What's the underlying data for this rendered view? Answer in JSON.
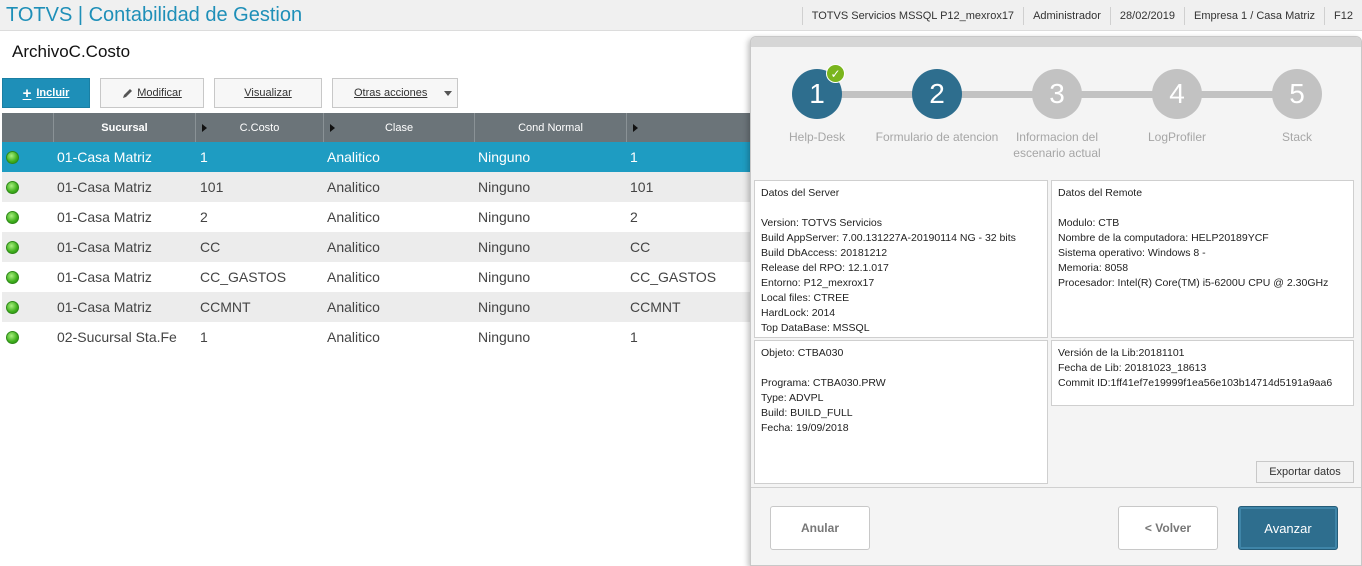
{
  "app": {
    "title": "TOTVS | Contabilidad de Gestion",
    "server": "TOTVS Servicios MSSQL P12_mexrox17",
    "user": "Administrador",
    "date": "28/02/2019",
    "company": "Empresa 1 / Casa Matriz",
    "key": "F12"
  },
  "page": {
    "title": "ArchivoC.Costo"
  },
  "toolbar": {
    "incluir": "Incluir",
    "modificar": "Modificar",
    "visualizar": "Visualizar",
    "otras": "Otras acciones"
  },
  "grid": {
    "columns": [
      "Sucursal",
      "C.Costo",
      "Clase",
      "Cond Normal",
      ""
    ],
    "rows": [
      [
        "01-Casa Matriz",
        "1",
        "Analitico",
        "Ninguno",
        "1"
      ],
      [
        "01-Casa Matriz",
        "101",
        "Analitico",
        "Ninguno",
        "101"
      ],
      [
        "01-Casa Matriz",
        "2",
        "Analitico",
        "Ninguno",
        "2"
      ],
      [
        "01-Casa Matriz",
        "CC",
        "Analitico",
        "Ninguno",
        "CC"
      ],
      [
        "01-Casa Matriz",
        "CC_GASTOS",
        "Analitico",
        "Ninguno",
        "CC_GASTOS"
      ],
      [
        "01-Casa Matriz",
        "CCMNT",
        "Analitico",
        "Ninguno",
        "CCMNT"
      ],
      [
        "02-Sucursal Sta.Fe",
        "1",
        "Analitico",
        "Ninguno",
        "1"
      ]
    ],
    "selected_row": 0,
    "status_color": "#3fae1c"
  },
  "wizard": {
    "steps": [
      {
        "number": "1",
        "label": "Help-Desk",
        "state": "done"
      },
      {
        "number": "2",
        "label": "Formulario de atencion",
        "state": "current"
      },
      {
        "number": "3",
        "label": "Informacion del escenario actual",
        "state": "pending"
      },
      {
        "number": "4",
        "label": "LogProfiler",
        "state": "pending"
      },
      {
        "number": "5",
        "label": "Stack",
        "state": "pending"
      }
    ],
    "server_box": {
      "title": "Datos del Server",
      "lines": [
        "Version: TOTVS Servicios",
        "Build AppServer: 7.00.131227A-20190114 NG - 32 bits",
        "Build DbAccess: 20181212",
        "Release del RPO:  12.1.017",
        "Entorno: P12_mexrox17",
        "Local files: CTREE",
        "HardLock: 2014",
        "Top DataBase: MSSQL"
      ]
    },
    "remote_box": {
      "title": "Datos del Remote",
      "lines": [
        "Modulo: CTB",
        "Nombre de la computadora: HELP20189YCF",
        "Sistema operativo: Windows 8 -",
        "Memoria: 8058",
        "Procesador: Intel(R) Core(TM) i5-6200U CPU @ 2.30GHz"
      ]
    },
    "object_box": {
      "title": "Objeto: CTBA030",
      "lines": [
        "Programa: CTBA030.PRW",
        "Type: ADVPL",
        "Build: BUILD_FULL",
        "Fecha: 19/09/2018"
      ]
    },
    "lib_box": {
      "lines": [
        "Versión de la Lib:20181101",
        "Fecha de Lib: 20181023_18613",
        "Commit ID:1ff41ef7e19999f1ea56e103b14714d5191a9aa6"
      ]
    },
    "export_label": "Exportar datos",
    "anular": "Anular",
    "volver": "< Volver",
    "avanzar": "Avanzar",
    "accent_color": "#2e6e8e",
    "check_color": "#7ab51d"
  }
}
